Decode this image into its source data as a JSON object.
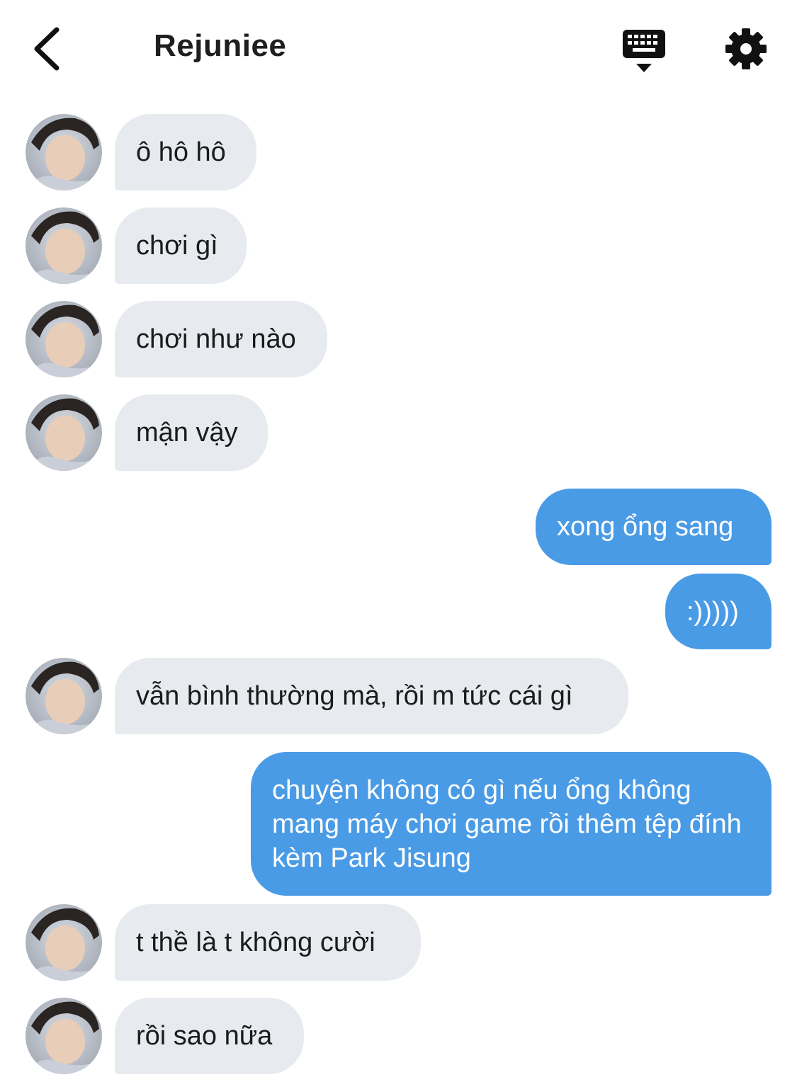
{
  "header": {
    "title": "Rejuniee",
    "back_icon": "chevron-left-icon",
    "keyboard_icon": "keyboard-icon",
    "settings_icon": "gear-icon"
  },
  "colors": {
    "incoming_bubble": "#e7eaee",
    "outgoing_bubble": "#4a9be6",
    "text_dark": "#1b1b1b"
  },
  "messages": [
    {
      "side": "in",
      "text": "ô hô hô"
    },
    {
      "side": "in",
      "text": "chơi gì"
    },
    {
      "side": "in",
      "text": "chơi như nào"
    },
    {
      "side": "in",
      "text": "mận vậy"
    },
    {
      "side": "out",
      "text": "xong ổng sang"
    },
    {
      "side": "out",
      "text": ":)))))"
    },
    {
      "side": "in",
      "text": "vẫn bình thường mà, rồi m tức cái gì"
    },
    {
      "side": "out",
      "text": "chuyện không có gì nếu ổng không mang máy chơi game rồi thêm tệp đính kèm Park Jisung"
    },
    {
      "side": "in",
      "text": "t thề là t không cười"
    },
    {
      "side": "in",
      "text": "rồi sao nữa"
    }
  ]
}
